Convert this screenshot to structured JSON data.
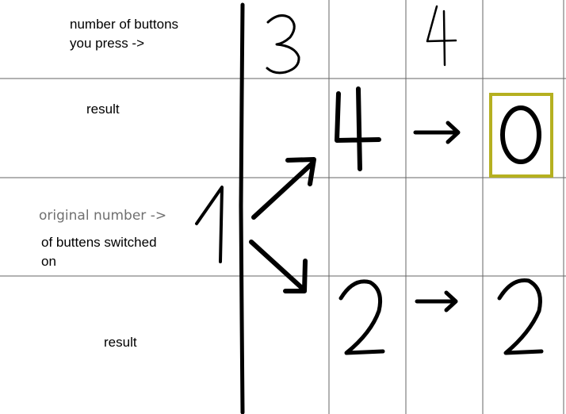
{
  "labels": {
    "buttons_line1": "number of buttons",
    "buttons_line2": "you press ->",
    "result_top": "result",
    "original_line1": "original number ->",
    "original_line2": "of buttens switched",
    "original_line3": "on",
    "result_bottom": "result"
  },
  "handwritten": {
    "press_count_a": "3",
    "press_count_b": "4",
    "original_number": "1",
    "result_top_first": "4",
    "result_top_second": "0",
    "result_bottom_first": "2",
    "result_bottom_second": "2"
  },
  "colors": {
    "grid": "#666666",
    "ink": "#000000",
    "highlight": "#b5b020"
  }
}
